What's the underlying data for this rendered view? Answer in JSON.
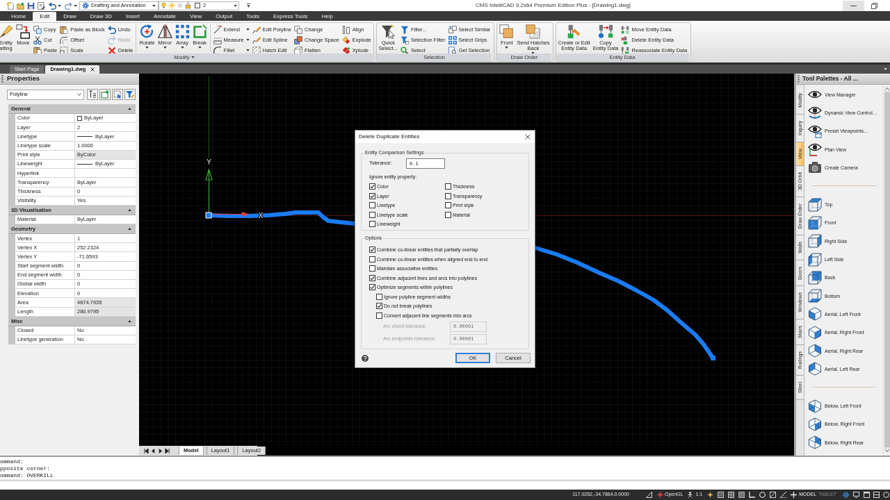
{
  "title_bar": {
    "workspace": "Drafting and Annotation",
    "layer": "2",
    "title": "CMS IntelliCAD 9.2x64 Premium Edition Plus - [Drawing1.dwg]"
  },
  "ribbon_tabs": [
    {
      "label": "Home",
      "selected": false
    },
    {
      "label": "Edit",
      "selected": true
    },
    {
      "label": "Draw",
      "selected": false
    },
    {
      "label": "Draw 3D",
      "selected": false
    },
    {
      "label": "Insert",
      "selected": false
    },
    {
      "label": "Annotate",
      "selected": false
    },
    {
      "label": "View",
      "selected": false
    },
    {
      "label": "Output",
      "selected": false
    },
    {
      "label": "Tools",
      "selected": false
    },
    {
      "label": "Express Tools",
      "selected": false
    },
    {
      "label": "Help",
      "selected": false
    }
  ],
  "ribbon_panels": [
    {
      "title": "Modify",
      "menu": true,
      "sections": [
        [
          {
            "kind": "large",
            "tools": [
              {
                "label": "Entity\natting",
                "dropdown": false,
                "disabled": false
              }
            ]
          },
          {
            "kind": "large",
            "tools": [
              {
                "label": "Move",
                "dropdown": false,
                "disabled": false
              }
            ]
          },
          {
            "kind": "small",
            "tools": [
              {
                "label": "Copy",
                "dropdown": false,
                "disabled": false
              },
              {
                "label": "Cut",
                "dropdown": false,
                "disabled": false
              },
              {
                "label": "Paste",
                "dropdown": false,
                "disabled": false
              }
            ]
          },
          {
            "kind": "small",
            "tools": [
              {
                "label": "Paste as Block",
                "dropdown": false,
                "disabled": false
              },
              {
                "label": "Offset",
                "dropdown": false,
                "disabled": false
              },
              {
                "label": "Scale",
                "dropdown": false,
                "disabled": false
              }
            ]
          },
          {
            "kind": "small",
            "tools": [
              {
                "label": "Undo",
                "dropdown": false,
                "disabled": false
              },
              {
                "label": "Redo",
                "dropdown": false,
                "disabled": true
              },
              {
                "label": "Delete",
                "dropdown": false,
                "disabled": false
              }
            ]
          }
        ],
        [
          {
            "kind": "large",
            "tools": [
              {
                "label": "Rotate",
                "dropdown": true,
                "disabled": false
              }
            ]
          },
          {
            "kind": "large",
            "tools": [
              {
                "label": "Mirror",
                "dropdown": true,
                "disabled": false
              }
            ]
          },
          {
            "kind": "large",
            "tools": [
              {
                "label": "Array",
                "dropdown": true,
                "disabled": false
              }
            ]
          },
          {
            "kind": "large",
            "tools": [
              {
                "label": "Break",
                "dropdown": true,
                "disabled": false
              }
            ]
          }
        ],
        [
          {
            "kind": "small",
            "tools": [
              {
                "label": "Extend",
                "dropdown": true,
                "disabled": false
              },
              {
                "label": "Measure",
                "dropdown": true,
                "disabled": false
              },
              {
                "label": "Fillet",
                "dropdown": true,
                "disabled": false
              }
            ]
          },
          {
            "kind": "small",
            "tools": [
              {
                "label": "Edit Polyline",
                "dropdown": false,
                "disabled": false
              },
              {
                "label": "Edit Spline",
                "dropdown": false,
                "disabled": false
              },
              {
                "label": "Hatch Edit",
                "dropdown": false,
                "disabled": false
              }
            ]
          },
          {
            "kind": "small",
            "tools": [
              {
                "label": "Change",
                "dropdown": false,
                "disabled": false
              },
              {
                "label": "Change Space",
                "dropdown": false,
                "disabled": false
              },
              {
                "label": "Flatten",
                "dropdown": false,
                "disabled": false
              }
            ]
          },
          {
            "kind": "small",
            "tools": [
              {
                "label": "Align",
                "dropdown": false,
                "disabled": false
              },
              {
                "label": "Explode",
                "dropdown": false,
                "disabled": false
              },
              {
                "label": "Xplode",
                "dropdown": false,
                "disabled": false
              }
            ]
          }
        ]
      ]
    },
    {
      "title": "Selection",
      "menu": false,
      "sections": [
        [
          {
            "kind": "large",
            "tools": [
              {
                "label": "Quick\nSelect...",
                "dropdown": false,
                "disabled": false
              }
            ]
          },
          {
            "kind": "small",
            "tools": [
              {
                "label": "Filter...",
                "dropdown": false,
                "disabled": false
              },
              {
                "label": "Selection Filter",
                "dropdown": false,
                "disabled": false
              },
              {
                "label": "Select",
                "dropdown": false,
                "disabled": false
              }
            ]
          },
          {
            "kind": "small",
            "tools": [
              {
                "label": "Select Similar",
                "dropdown": false,
                "disabled": false
              },
              {
                "label": "Select Grips",
                "dropdown": false,
                "disabled": false
              },
              {
                "label": "Get Selection",
                "dropdown": false,
                "disabled": false
              }
            ]
          }
        ]
      ]
    },
    {
      "title": "Draw Order",
      "menu": false,
      "sections": [
        [
          {
            "kind": "large",
            "tools": [
              {
                "label": "Front",
                "dropdown": true,
                "disabled": false
              }
            ]
          },
          {
            "kind": "large",
            "tools": [
              {
                "label": "Send Hatches\nBack",
                "dropdown": true,
                "disabled": false
              }
            ]
          }
        ]
      ]
    },
    {
      "title": "Entity Data",
      "menu": false,
      "sections": [
        [
          {
            "kind": "large",
            "tools": [
              {
                "label": "Create or Edit\nEntity Data",
                "dropdown": false,
                "disabled": false
              }
            ]
          },
          {
            "kind": "large",
            "tools": [
              {
                "label": "Copy\nEntity Data",
                "dropdown": false,
                "disabled": false
              }
            ]
          },
          {
            "kind": "small",
            "tools": [
              {
                "label": "Move Entity Data",
                "dropdown": false,
                "disabled": false
              },
              {
                "label": "Delete Entity Data",
                "dropdown": false,
                "disabled": false
              },
              {
                "label": "Reassociate Entity Data",
                "dropdown": false,
                "disabled": false
              }
            ]
          }
        ]
      ]
    }
  ],
  "document_tabs": [
    {
      "label": "Start Page",
      "selected": false
    },
    {
      "label": "Drawing1.dwg",
      "selected": true
    }
  ],
  "properties": {
    "title": "Properties",
    "selector": "Polyline",
    "sections": [
      {
        "title": "General",
        "expanded": true,
        "rows": [
          {
            "name": "Color",
            "value": "ByLayer",
            "kind": "swatch",
            "read_only": false
          },
          {
            "name": "Layer",
            "value": "2",
            "kind": "text",
            "read_only": false
          },
          {
            "name": "Linetype",
            "value": "ByLayer",
            "kind": "line",
            "read_only": false
          },
          {
            "name": "Linetype scale",
            "value": "1.0000",
            "kind": "text",
            "read_only": false
          },
          {
            "name": "Print style",
            "value": "ByColor",
            "kind": "text",
            "read_only": true
          },
          {
            "name": "Lineweight",
            "value": "ByLayer",
            "kind": "line",
            "read_only": false
          },
          {
            "name": "Hyperlink",
            "kind": "text",
            "read_only": false
          },
          {
            "name": "Transparency",
            "value": "ByLayer",
            "kind": "text",
            "read_only": false
          },
          {
            "name": "Thickness",
            "value": "0",
            "kind": "text",
            "read_only": false
          },
          {
            "name": "Visibility",
            "value": "Yes",
            "kind": "text",
            "read_only": false
          }
        ]
      },
      {
        "title": "3D Visualisation",
        "expanded": true,
        "rows": [
          {
            "name": "Material",
            "value": "ByLayer",
            "kind": "text",
            "read_only": false
          }
        ]
      },
      {
        "title": "Geometry",
        "expanded": true,
        "rows": [
          {
            "name": "Vertex",
            "value": "1",
            "kind": "text",
            "read_only": false
          },
          {
            "name": "Vertex X",
            "value": "252.2324",
            "kind": "text",
            "read_only": false
          },
          {
            "name": "Vertex Y",
            "value": "-71.6593",
            "kind": "text",
            "read_only": false
          },
          {
            "name": "Start segment width",
            "value": "0",
            "kind": "text",
            "read_only": false
          },
          {
            "name": "End segment width",
            "value": "0",
            "kind": "text",
            "read_only": false
          },
          {
            "name": "Global width",
            "value": "0",
            "kind": "text",
            "read_only": false
          },
          {
            "name": "Elevation",
            "value": "0",
            "kind": "text",
            "read_only": false
          },
          {
            "name": "Area",
            "value": "4674.7935",
            "kind": "text",
            "read_only": true
          },
          {
            "name": "Length",
            "value": "280.9795",
            "kind": "text",
            "read_only": true
          }
        ]
      },
      {
        "title": "Misc",
        "expanded": true,
        "rows": [
          {
            "name": "Closed",
            "value": "No",
            "kind": "text",
            "read_only": false
          },
          {
            "name": "Linetype generation",
            "value": "No",
            "kind": "text",
            "read_only": false
          }
        ]
      }
    ]
  },
  "drawing": {
    "ucs": {
      "x_label": "X",
      "y_label": "Y"
    }
  },
  "layout_tabs": [
    {
      "label": "Model",
      "selected": true
    },
    {
      "label": "Layout1",
      "selected": false
    },
    {
      "label": "Layout2",
      "selected": false
    }
  ],
  "dialog": {
    "title": "Delete Duplicate Entities",
    "comparison": {
      "legend": "Entity Comparison Settings",
      "tolerance_label": "Tolerance:",
      "tolerance": "0.1",
      "ignore_label": "Ignore entity property:",
      "properties": [
        {
          "label": "Color",
          "checked": true
        },
        {
          "label": "Layer",
          "checked": true
        },
        {
          "label": "Linetype",
          "checked": false
        },
        {
          "label": "Linetype scale",
          "checked": false
        },
        {
          "label": "Lineweight",
          "checked": false
        },
        {
          "label": "Thickness",
          "checked": false
        },
        {
          "label": "Transparency",
          "checked": false
        },
        {
          "label": "Print style",
          "checked": false
        },
        {
          "label": "Material",
          "checked": false
        }
      ]
    },
    "options": {
      "legend": "Options",
      "items": [
        {
          "label": "Combine co-linear entities that partially overlap",
          "checked": true
        },
        {
          "label": "Combine co-linear entities when aligned end to end",
          "checked": false
        },
        {
          "label": "Maintain associative entities",
          "checked": false
        },
        {
          "label": "Combine adjacent lines and arcs into polylines",
          "checked": true
        },
        {
          "label": "Optimize segments within polylines",
          "checked": true,
          "children": [
            {
              "label": "Ignore polyline segment widths",
              "checked": false
            },
            {
              "label": "Do not break polylines",
              "checked": true
            },
            {
              "label": "Convert adjacent line segments into arcs",
              "checked": false
            }
          ]
        }
      ],
      "fields": [
        {
          "label": "Arc chord tolerance:",
          "value": "0.00001",
          "disabled": true
        },
        {
          "label": "Arc endpoints tolerance:",
          "value": "0.00001",
          "disabled": true
        }
      ]
    },
    "buttons": [
      {
        "label": "OK",
        "default": true
      },
      {
        "label": "Cancel",
        "default": false
      }
    ]
  },
  "tool_palette": {
    "title": "Tool Palettes - All ...",
    "tabs": [
      {
        "label": "Modify",
        "selected": false
      },
      {
        "label": "Inquiry",
        "selected": false
      },
      {
        "label": "View",
        "selected": true
      },
      {
        "label": "3D Orbit",
        "selected": false
      },
      {
        "label": "Draw Order",
        "selected": false
      },
      {
        "label": "Walls",
        "selected": false
      },
      {
        "label": "Doors",
        "selected": false
      },
      {
        "label": "Windows",
        "selected": false
      },
      {
        "label": "Stairs",
        "selected": false
      },
      {
        "label": "Railings",
        "selected": false
      },
      {
        "label": "Steel",
        "selected": false
      }
    ],
    "groups": [
      {
        "items": [
          {
            "label": "View Manager"
          },
          {
            "label": "Dynamic View Control..."
          },
          {
            "label": "Preset Viewpoints..."
          },
          {
            "label": "Plan View"
          },
          {
            "label": "Create Camera"
          }
        ]
      },
      {
        "items": [
          {
            "label": "Top"
          },
          {
            "label": "Front"
          },
          {
            "label": "Right Side"
          },
          {
            "label": "Left Side"
          },
          {
            "label": "Back"
          },
          {
            "label": "Bottom"
          },
          {
            "label": "Aerial, Left Front"
          },
          {
            "label": "Aerial, Right Front"
          },
          {
            "label": "Aerial, Right Rear"
          },
          {
            "label": "Aerial, Left Rear"
          }
        ]
      },
      {
        "items": [
          {
            "label": "Below, Left Front"
          },
          {
            "label": "Below, Right Front"
          },
          {
            "label": "Below, Right Rear"
          }
        ]
      }
    ]
  },
  "command_history": [
    "ommand:",
    "pposite corner:",
    "ommand: OVERKILL"
  ],
  "status_bar": {
    "coordinates": "117.0252,-34.7864,0.0000",
    "renderer": "OpenGL",
    "scale": "1:1",
    "modes": [
      {
        "label": "MODEL",
        "on": true
      },
      {
        "label": "TABLET",
        "on": false
      }
    ]
  }
}
